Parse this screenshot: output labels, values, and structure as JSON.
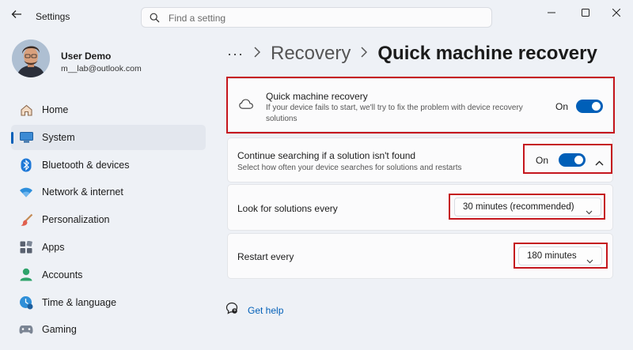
{
  "window": {
    "app_title": "Settings",
    "search_placeholder": "Find a setting"
  },
  "user": {
    "name": "User Demo",
    "email": "m__lab@outlook.com"
  },
  "sidebar": {
    "items": [
      {
        "label": "Home",
        "icon": "home-icon"
      },
      {
        "label": "System",
        "icon": "system-icon",
        "selected": true
      },
      {
        "label": "Bluetooth & devices",
        "icon": "bluetooth-icon"
      },
      {
        "label": "Network & internet",
        "icon": "wifi-icon"
      },
      {
        "label": "Personalization",
        "icon": "brush-icon"
      },
      {
        "label": "Apps",
        "icon": "apps-icon"
      },
      {
        "label": "Accounts",
        "icon": "accounts-icon"
      },
      {
        "label": "Time & language",
        "icon": "time-language-icon"
      },
      {
        "label": "Gaming",
        "icon": "gaming-icon"
      }
    ]
  },
  "breadcrumb": {
    "more": "···",
    "parent": "Recovery",
    "current": "Quick machine recovery"
  },
  "settings": {
    "qmr": {
      "title": "Quick machine recovery",
      "description": "If your device fails to start, we'll try to fix the problem with device recovery solutions",
      "state_label": "On",
      "on": true
    },
    "continue_search": {
      "title": "Continue searching if a solution isn't found",
      "description": "Select how often your device searches for solutions and restarts",
      "state_label": "On",
      "on": true
    },
    "look_for": {
      "label": "Look for solutions every",
      "value": "30 minutes (recommended)"
    },
    "restart": {
      "label": "Restart every",
      "value": "180 minutes"
    }
  },
  "help": {
    "label": "Get help"
  },
  "colors": {
    "accent": "#005fb8",
    "highlight": "#c5161d",
    "background": "#eef1f6"
  }
}
